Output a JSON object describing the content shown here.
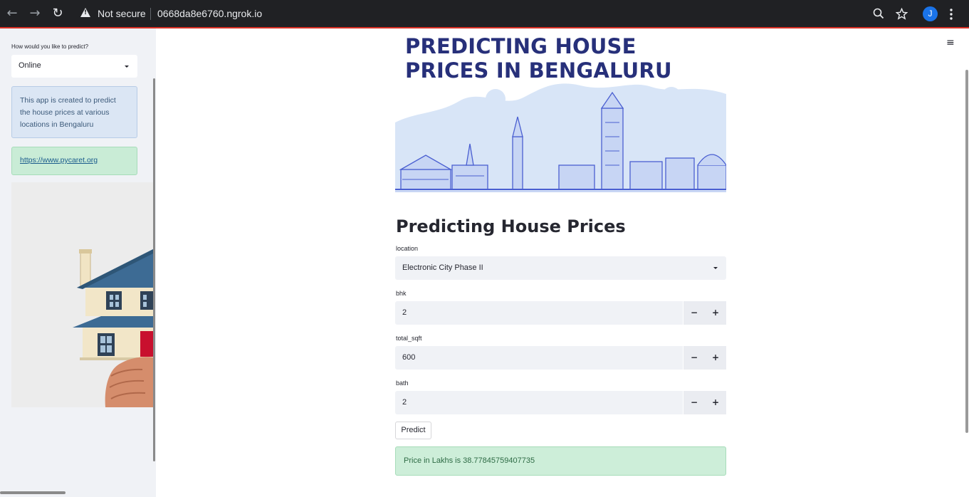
{
  "browser": {
    "security_label": "Not secure",
    "url": "0668da8e6760.ngrok.io",
    "avatar_letter": "J"
  },
  "sidebar": {
    "predict_label": "How would you like to predict?",
    "predict_value": "Online",
    "info_text": "This app is created to predict the house prices at various locations in Bengaluru",
    "link_text": "https://www.pycaret.org"
  },
  "banner": {
    "line1": "PREDICTING HOUSE",
    "line2": "PRICES IN BENGALURU"
  },
  "main": {
    "title": "Predicting House Prices",
    "fields": {
      "location": {
        "label": "location",
        "value": "Electronic City Phase II"
      },
      "bhk": {
        "label": "bhk",
        "value": "2"
      },
      "total_sqft": {
        "label": "total_sqft",
        "value": "600"
      },
      "bath": {
        "label": "bath",
        "value": "2"
      }
    },
    "step_minus": "−",
    "step_plus": "+",
    "predict_button": "Predict",
    "result_text": "Price in Lakhs is 38.77845759407735"
  },
  "colors": {
    "chrome_bg": "#202124",
    "sidebar_bg": "#f0f2f6",
    "banner_title": "#27307a",
    "info_bg": "#dbe6f4",
    "success_bg": "#cdeed9"
  }
}
